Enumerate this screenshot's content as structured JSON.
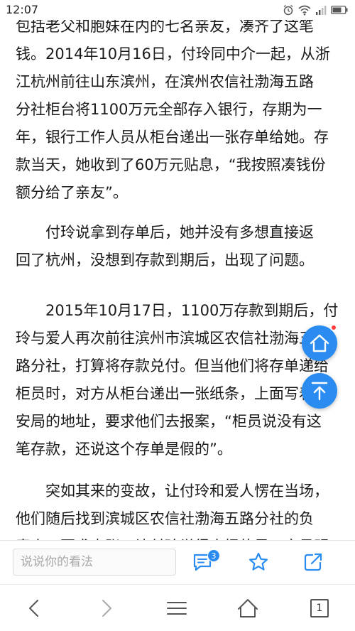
{
  "status_bar": {
    "time": "12:07",
    "icons": [
      "alarm-icon",
      "wifi-icon",
      "signal-icon",
      "battery-icon"
    ]
  },
  "article": {
    "paragraphs": [
      {
        "lines": [
          "包括老父和胞妹在内的七名亲友，凑齐了这笔",
          "钱。2014年10月16日，付玲同中介一起，从浙",
          "江杭州前往山东滨州，在滨州农信社渤海五路",
          "分社柜台将1100万元全部存入银行，存期为一",
          "年，银行工作人员从柜台递出一张存单给她。存",
          "款当天，她收到了60万元贴息，“我按照凑钱份",
          "额分给了亲友”。"
        ]
      },
      {
        "lines": [
          "　　付玲说拿到存单后，她并没有多想直接返",
          "回了杭州，没想到存款到期后，出现了问题。"
        ]
      },
      {
        "lines": [
          "　　2015年10月17日，1100万存款到期后，付",
          "玲与爱人再次前往滨州市滨城区农信社渤海五",
          "路分社，打算将存款兑付。但当他们将存单递给",
          "柜员时，对方从柜台递出一张纸条，上面写着公",
          "安局的地址，要求他们去报案，“柜员说没有这",
          "笔存款，还说这个存单是假的”。"
        ]
      },
      {
        "lines": [
          "　　突如其来的变故，让付玲和爱人愣在当场，",
          "他们随后找到滨城区农信社渤海五路分社的负",
          "责人，要求查账。让付玲觉得奇怪的是，交易明"
        ]
      }
    ]
  },
  "floating": {
    "home_icon": "home-icon",
    "top_icon": "arrow-up-icon"
  },
  "comment_bar": {
    "placeholder": "说说你的看法",
    "comment_count": "3",
    "icons": [
      "comment-icon",
      "star-icon",
      "share-icon"
    ]
  },
  "nav_bar": {
    "icons": [
      "back-icon",
      "forward-icon",
      "menu-icon",
      "home-icon",
      "tabs-icon"
    ],
    "tab_count": "1"
  },
  "colors": {
    "accent": "#2a8cf0",
    "badge_dot": "#ff3b3b",
    "text": "#1a1a1a"
  }
}
